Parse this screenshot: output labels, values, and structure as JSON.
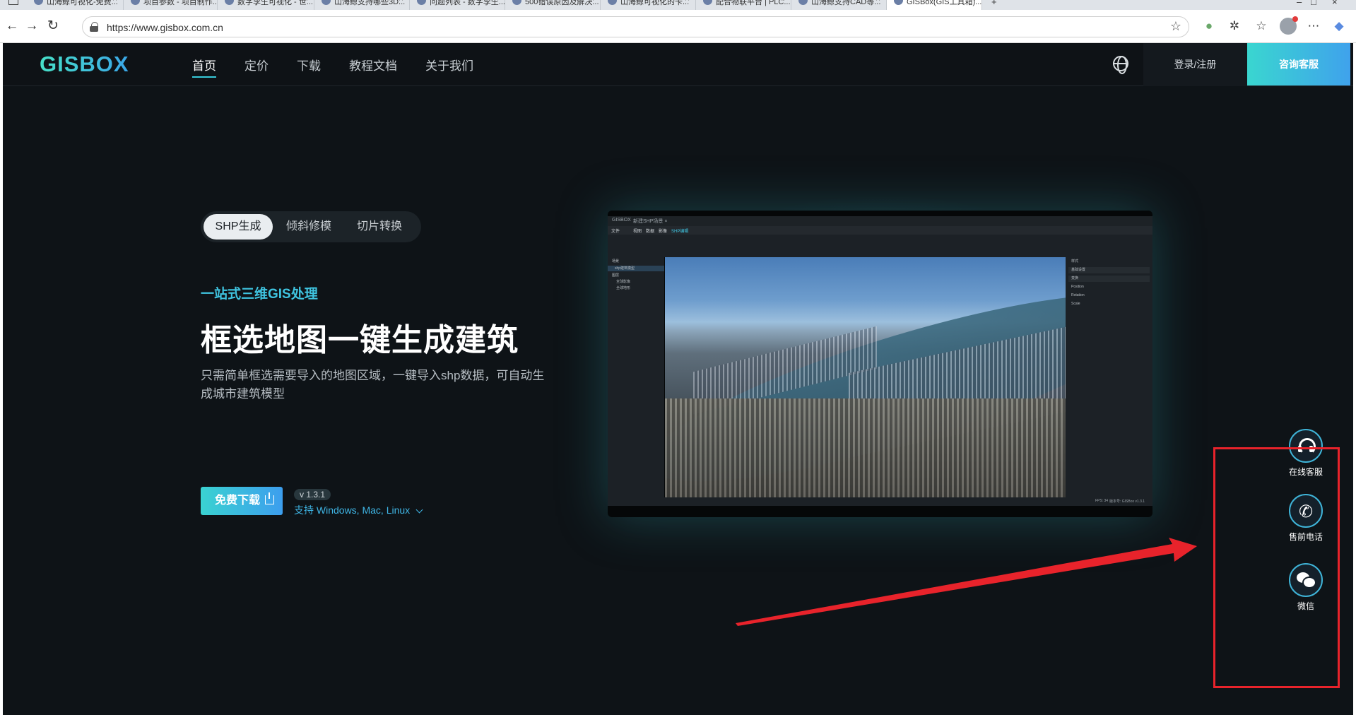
{
  "browser": {
    "tabs": [
      {
        "label": "山海鲸可视化-免费..."
      },
      {
        "label": "项目参数 - 项目制作..."
      },
      {
        "label": "数字孪生可视化 - 世..."
      },
      {
        "label": "山海鲸支持哪些3D..."
      },
      {
        "label": "问题列表 - 数字孪生..."
      },
      {
        "label": "500错误原因及解决..."
      },
      {
        "label": "山海鲸可视化的卡..."
      },
      {
        "label": "配合物联平台 | PLC..."
      },
      {
        "label": "山海鲸支持CAD等..."
      },
      {
        "label": "GISBox(GIS工具箱)..."
      }
    ],
    "url": "https://www.gisbox.com.cn"
  },
  "header": {
    "logo": "GISBOX",
    "nav": [
      "首页",
      "定价",
      "下载",
      "教程文档",
      "关于我们"
    ],
    "login": "登录/注册",
    "consult": "咨询客服"
  },
  "hero": {
    "tabs": [
      "SHP生成",
      "倾斜修模",
      "切片转换"
    ],
    "eyebrow": "一站式三维GIS处理",
    "title": "框选地图一键生成建筑",
    "desc": "只需简单框选需要导入的地图区域，一键导入shp数据，可自动生成城市建筑模型",
    "download": "免费下载",
    "version": "v 1.3.1",
    "platforms": "支持 Windows, Mac, Linux"
  },
  "app_preview": {
    "app_name": "GISBOX",
    "doc_tab": "新建SHP场景 ×",
    "menu": [
      "文件",
      "视图",
      "数据",
      "影像",
      "SHP编辑"
    ],
    "tree": [
      "场景",
      "shp建筑模型",
      "图层",
      "全球影像",
      "全球地形"
    ],
    "props": [
      "样式",
      "基础设置",
      "变换",
      "Position",
      "Rotation",
      "Scale"
    ],
    "status": [
      "FPS: 34",
      "版本号: GISBox v1.3.1"
    ]
  },
  "service": {
    "items": [
      {
        "label": "在线客服",
        "icon": "headset-icon"
      },
      {
        "label": "售前电话",
        "icon": "phone-icon"
      },
      {
        "label": "微信",
        "icon": "wechat-icon"
      }
    ]
  },
  "colors": {
    "accent": "#3fb4d8",
    "annotation": "#e8232b",
    "bg": "#0e1317"
  }
}
